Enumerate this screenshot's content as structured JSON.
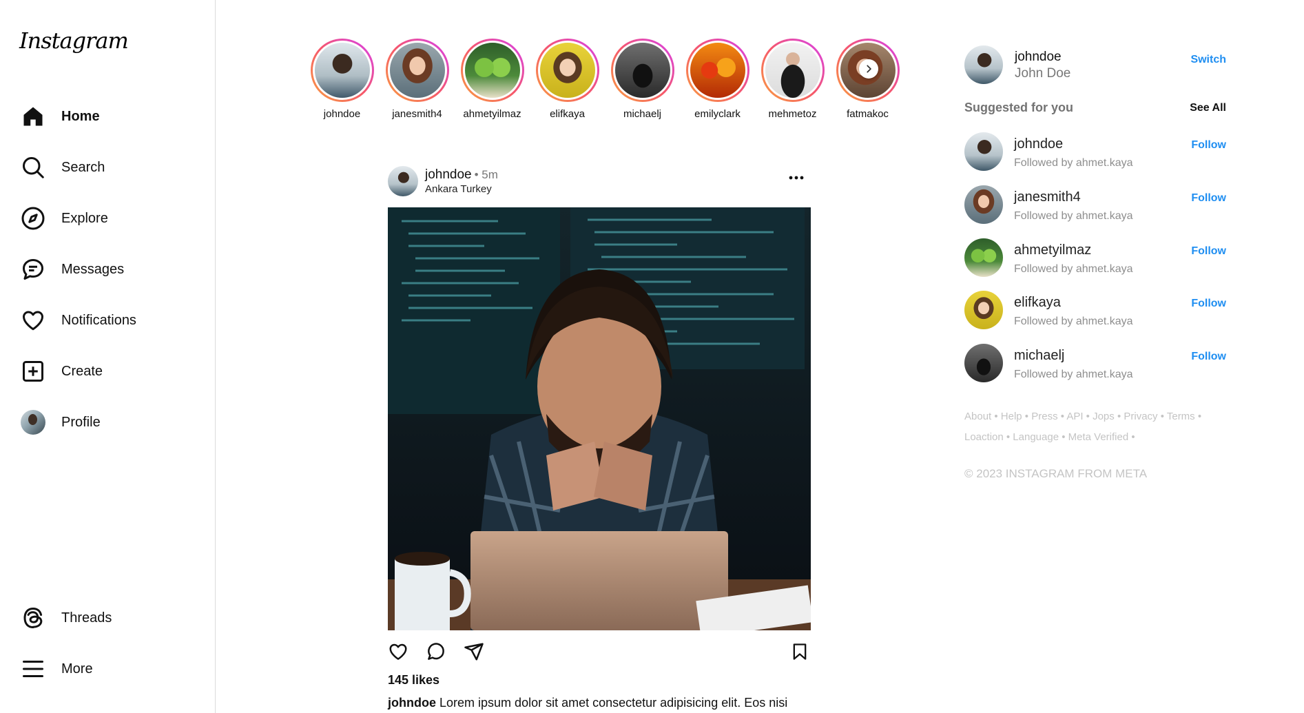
{
  "brand": {
    "logo_text": "Instagram"
  },
  "sidebar": {
    "items": [
      {
        "label": "Home",
        "icon": "home-icon",
        "active": true
      },
      {
        "label": "Search",
        "icon": "search-icon"
      },
      {
        "label": "Explore",
        "icon": "compass-icon"
      },
      {
        "label": "Messages",
        "icon": "chat-bubble-icon"
      },
      {
        "label": "Notifications",
        "icon": "heart-icon"
      },
      {
        "label": "Create",
        "icon": "plus-square-icon"
      },
      {
        "label": "Profile",
        "icon": "avatar"
      }
    ],
    "bottom_items": [
      {
        "label": "Threads",
        "icon": "threads-icon"
      },
      {
        "label": "More",
        "icon": "menu-icon"
      }
    ]
  },
  "stories": [
    "johndoe",
    "janesmith4",
    "ahmetyilmaz",
    "elifkaya",
    "michaelj",
    "emilyclark",
    "mehmetoz",
    "fatmakoc"
  ],
  "post": {
    "username": "johndoe",
    "time": "• 5m",
    "location": "Ankara Turkey",
    "likes": "145 likes",
    "caption_user": "johndoe",
    "caption_text": "Lorem ipsum dolor sit amet consectetur adipisicing elit. Eos nisi"
  },
  "current_user": {
    "username": "johndoe",
    "full_name": "John Doe",
    "switch_label": "Switch"
  },
  "suggestions": {
    "title": "Suggested for you",
    "see_all": "See All",
    "follow_label": "Follow",
    "items": [
      {
        "username": "johndoe",
        "subtitle": "Followed by ahmet.kaya"
      },
      {
        "username": "janesmith4",
        "subtitle": "Followed by ahmet.kaya"
      },
      {
        "username": "ahmetyilmaz",
        "subtitle": "Followed by ahmet.kaya"
      },
      {
        "username": "elifkaya",
        "subtitle": "Followed by ahmet.kaya"
      },
      {
        "username": "michaelj",
        "subtitle": "Followed by ahmet.kaya"
      }
    ]
  },
  "footer": {
    "line1": "About • Help • Press • API • Jops • Privacy • Terms •",
    "line2": "Loaction • Language • Meta Verified •",
    "copyright": "© 2023 INSTAGRAM FROM META"
  },
  "colors": {
    "accent": "#1f8ef1",
    "story_ring_start": "#f9a03f",
    "story_ring_end": "#d63ff0",
    "muted": "#8e8e8e"
  }
}
